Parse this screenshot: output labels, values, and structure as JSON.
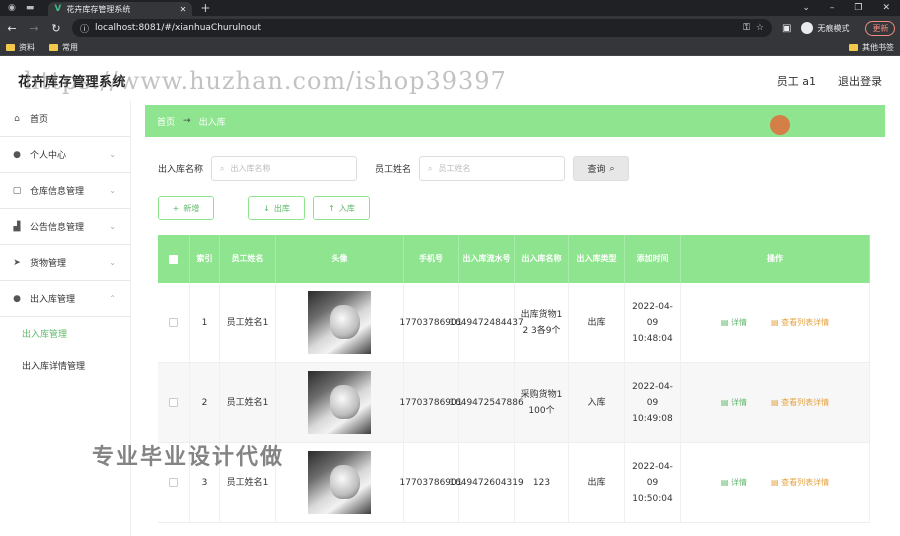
{
  "browser": {
    "tab_title": "花卉库存管理系统",
    "url": "localhost:8081/#/xianhuaChurulnout",
    "profile_label": "无痕模式",
    "update_label": "更新",
    "bookmarks": [
      "资料",
      "常用"
    ],
    "other_bookmarks": "其他书签"
  },
  "header": {
    "brand": "花卉库存管理系统",
    "watermark": "https://www.huzhan.com/ishop39397",
    "user": "员工 a1",
    "logout": "退出登录"
  },
  "sidebar": {
    "items": [
      {
        "label": "首页",
        "icon": "home-icon"
      },
      {
        "label": "个人中心",
        "icon": "user-icon"
      },
      {
        "label": "仓库信息管理",
        "icon": "box-icon"
      },
      {
        "label": "公告信息管理",
        "icon": "chart-icon"
      },
      {
        "label": "货物管理",
        "icon": "send-icon"
      },
      {
        "label": "出入库管理",
        "icon": "user-icon"
      }
    ],
    "subitems": [
      {
        "label": "出入库管理"
      },
      {
        "label": "出入库详情管理"
      }
    ]
  },
  "breadcrumb": {
    "home": "首页",
    "arrow": "→",
    "current": "出入库"
  },
  "search": {
    "label1": "出入库名称",
    "placeholder1": "出入库名称",
    "label2": "员工姓名",
    "placeholder2": "员工姓名",
    "query": "查询"
  },
  "actions": {
    "add": "新增",
    "out": "出库",
    "in": "入库"
  },
  "table": {
    "headers": [
      "索引",
      "员工姓名",
      "头像",
      "手机号",
      "出入库流水号",
      "出入库名称",
      "出入库类型",
      "添加时间",
      "操作"
    ],
    "rows": [
      {
        "index": "1",
        "name": "员工姓名1",
        "phone": "17703786901",
        "serial": "1649472484437",
        "title": "出库货物1 2 3各9个",
        "type": "出库",
        "time": "2022-04-09 10:48:04"
      },
      {
        "index": "2",
        "name": "员工姓名1",
        "phone": "17703786901",
        "serial": "1649472547886",
        "title": "采购货物1 100个",
        "type": "入库",
        "time": "2022-04-09 10:49:08"
      },
      {
        "index": "3",
        "name": "员工姓名1",
        "phone": "17703786901",
        "serial": "1649472604319",
        "title": "123",
        "type": "出库",
        "time": "2022-04-09 10:50:04"
      }
    ],
    "op_detail": "详情",
    "op_list": "查看列表详情"
  },
  "overlay_text": "专业毕业设计代做",
  "colors": {
    "accent": "#8fe58f",
    "accent_text": "#5fb86a",
    "warn": "#e6a23c"
  }
}
